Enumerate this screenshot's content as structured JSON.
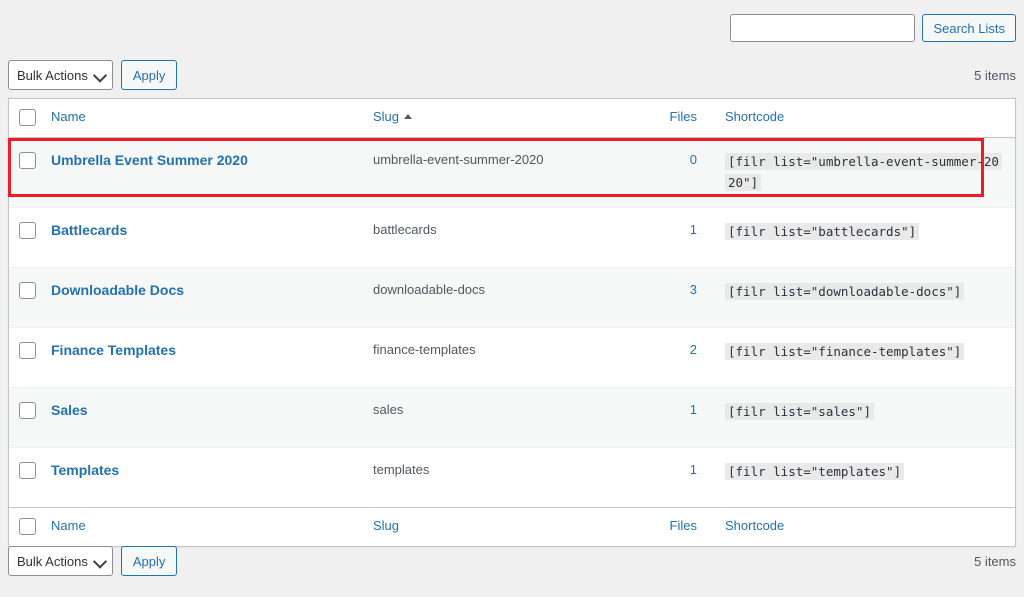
{
  "search": {
    "value": "",
    "placeholder": "",
    "button_label": "Search Lists"
  },
  "toolbar_top": {
    "bulk_actions_label": "Bulk Actions",
    "apply_label": "Apply",
    "items_count": "5 items"
  },
  "toolbar_bottom": {
    "bulk_actions_label": "Bulk Actions",
    "apply_label": "Apply",
    "items_count": "5 items"
  },
  "table": {
    "columns": {
      "name": "Name",
      "slug": "Slug",
      "files": "Files",
      "shortcode": "Shortcode"
    },
    "sort": {
      "column": "Slug",
      "direction": "ascending",
      "arrow": "triangle-up-icon"
    },
    "rows": [
      {
        "name": "Umbrella Event Summer 2020",
        "slug": "umbrella-event-summer-2020",
        "files": "0",
        "shortcode": "[filr list=\"umbrella-event-summer-2020\"]"
      },
      {
        "name": "Battlecards",
        "slug": "battlecards",
        "files": "1",
        "shortcode": "[filr list=\"battlecards\"]"
      },
      {
        "name": "Downloadable Docs",
        "slug": "downloadable-docs",
        "files": "3",
        "shortcode": "[filr list=\"downloadable-docs\"]"
      },
      {
        "name": "Finance Templates",
        "slug": "finance-templates",
        "files": "2",
        "shortcode": "[filr list=\"finance-templates\"]"
      },
      {
        "name": "Sales",
        "slug": "sales",
        "files": "1",
        "shortcode": "[filr list=\"sales\"]"
      },
      {
        "name": "Templates",
        "slug": "templates",
        "files": "1",
        "shortcode": "[filr list=\"templates\"]"
      }
    ]
  },
  "annotation": {
    "highlight_color": "#ee1c25",
    "target_row": "Umbrella Event Summer 2020"
  },
  "colors": {
    "link": "#2271b1",
    "page_background": "#f0f0f1",
    "row_alt_background": "#f6f7f7",
    "table_border": "#c3c4c7"
  }
}
